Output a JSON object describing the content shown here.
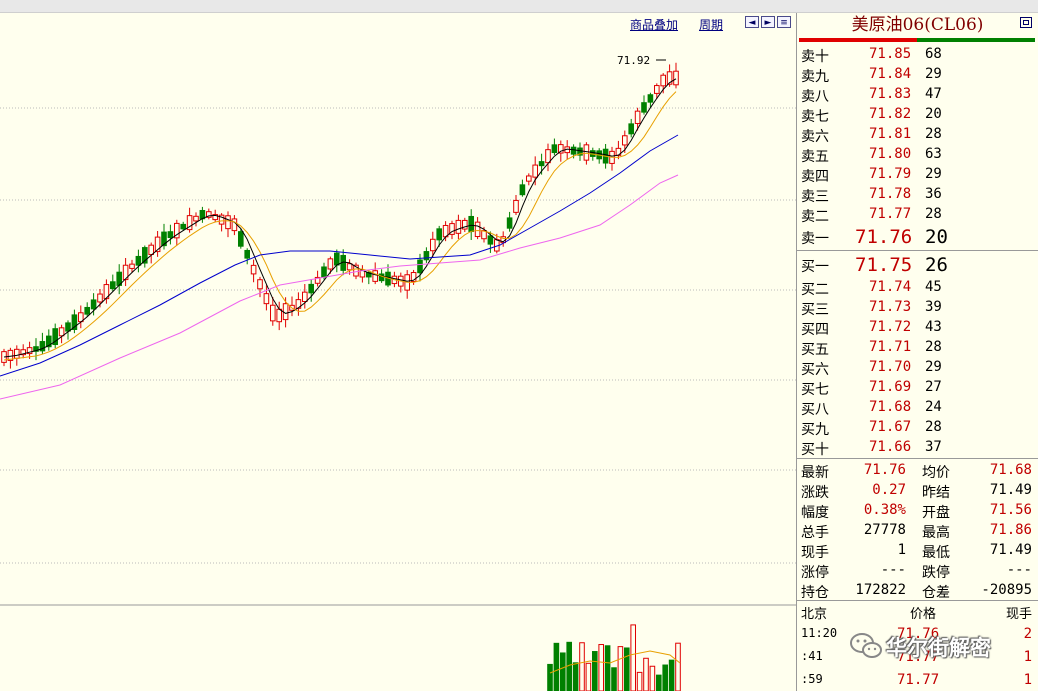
{
  "toolbar": {
    "overlay_label": "商品叠加",
    "period_label": "周期",
    "btn_left": "◄",
    "btn_right": "►",
    "btn_list": "≡"
  },
  "chart_annotation": "71.92",
  "colors": {
    "up": "#e00000",
    "down": "#008000",
    "ma5": "#000000",
    "ma10": "#e8a000",
    "ma20": "#0000cc",
    "ma60": "#ee66ee",
    "price": "#c00000",
    "background": "#ffffee"
  },
  "quote": {
    "title": "美原油06(CL06)",
    "asks": [
      {
        "label": "卖十",
        "price": "71.85",
        "vol": "68"
      },
      {
        "label": "卖九",
        "price": "71.84",
        "vol": "29"
      },
      {
        "label": "卖八",
        "price": "71.83",
        "vol": "47"
      },
      {
        "label": "卖七",
        "price": "71.82",
        "vol": "20"
      },
      {
        "label": "卖六",
        "price": "71.81",
        "vol": "28"
      },
      {
        "label": "卖五",
        "price": "71.80",
        "vol": "63"
      },
      {
        "label": "卖四",
        "price": "71.79",
        "vol": "29"
      },
      {
        "label": "卖三",
        "price": "71.78",
        "vol": "36"
      },
      {
        "label": "卖二",
        "price": "71.77",
        "vol": "28"
      },
      {
        "label": "卖一",
        "price": "71.76",
        "vol": "20"
      }
    ],
    "bids": [
      {
        "label": "买一",
        "price": "71.75",
        "vol": "26"
      },
      {
        "label": "买二",
        "price": "71.74",
        "vol": "45"
      },
      {
        "label": "买三",
        "price": "71.73",
        "vol": "39"
      },
      {
        "label": "买四",
        "price": "71.72",
        "vol": "43"
      },
      {
        "label": "买五",
        "price": "71.71",
        "vol": "28"
      },
      {
        "label": "买六",
        "price": "71.70",
        "vol": "29"
      },
      {
        "label": "买七",
        "price": "71.69",
        "vol": "27"
      },
      {
        "label": "买八",
        "price": "71.68",
        "vol": "24"
      },
      {
        "label": "买九",
        "price": "71.67",
        "vol": "28"
      },
      {
        "label": "买十",
        "price": "71.66",
        "vol": "37"
      }
    ],
    "stats": [
      {
        "l1": "最新",
        "v1": "71.76",
        "l2": "均价",
        "v2": "71.68"
      },
      {
        "l1": "涨跌",
        "v1": "0.27",
        "l2": "昨结",
        "v2": "71.49"
      },
      {
        "l1": "幅度",
        "v1": "0.38%",
        "l2": "开盘",
        "v2": "71.56"
      },
      {
        "l1": "总手",
        "v1": "27778",
        "l2": "最高",
        "v2": "71.86"
      },
      {
        "l1": "现手",
        "v1": "1",
        "l2": "最低",
        "v2": "71.49"
      },
      {
        "l1": "涨停",
        "v1": "---",
        "l2": "跌停",
        "v2": "---"
      },
      {
        "l1": "持仓",
        "v1": "172822",
        "l2": "仓差",
        "v2": "-20895"
      }
    ],
    "ticks_header": {
      "time": "北京",
      "price": "价格",
      "vol": "现手"
    },
    "ticks": [
      {
        "time": "11:20",
        "price": "71.76",
        "vol": "2"
      },
      {
        "time": ":41",
        "price": "71.77",
        "vol": "1"
      },
      {
        "time": ":59",
        "price": "71.77",
        "vol": "1"
      }
    ]
  },
  "watermark": "华尔街解密"
}
